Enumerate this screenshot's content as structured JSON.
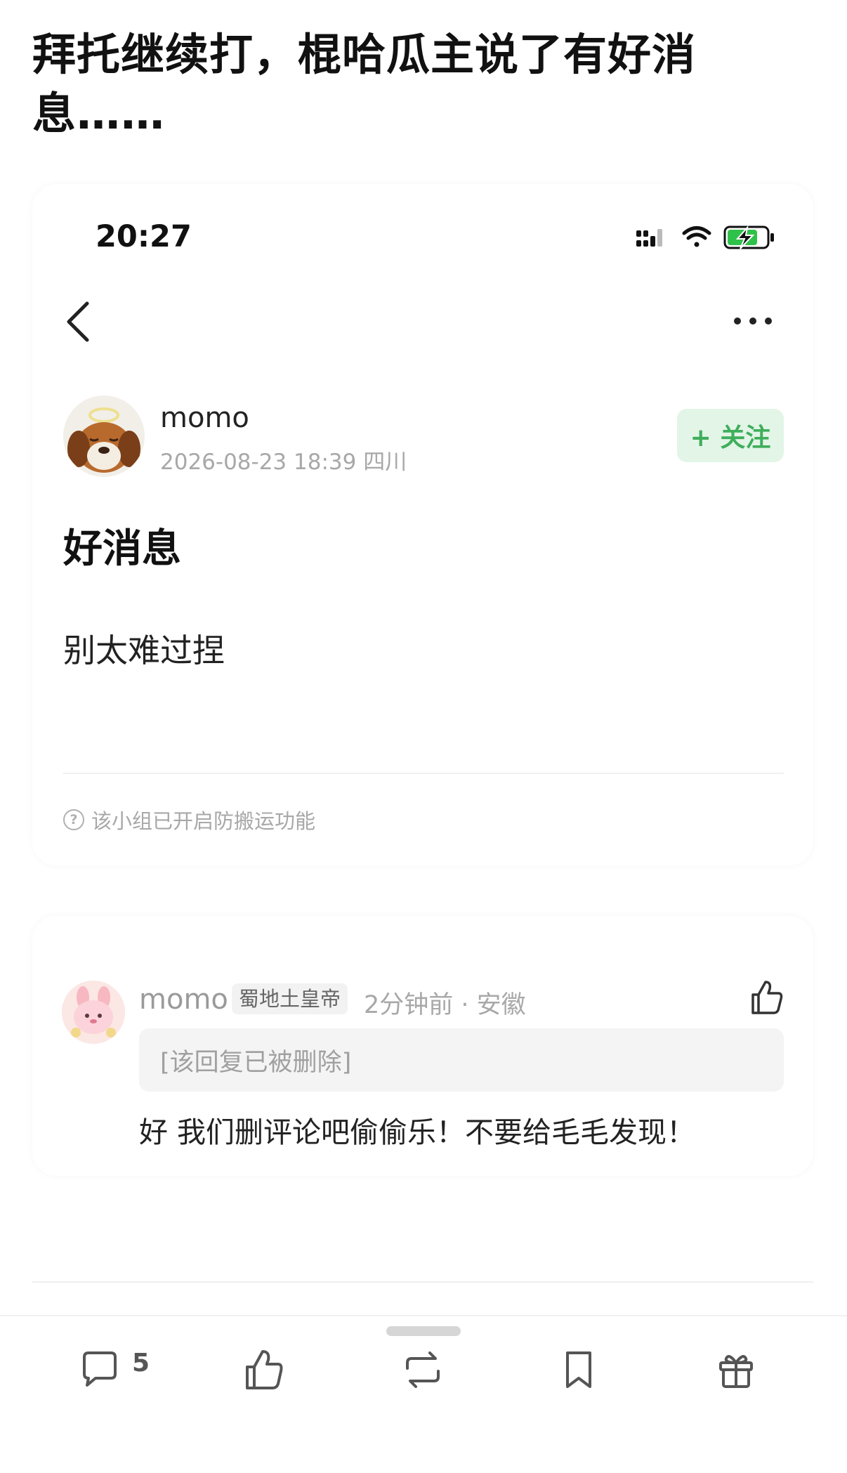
{
  "headline": "拜托继续打，棍哈瓜主说了有好消息……",
  "status_bar": {
    "time": "20:27"
  },
  "post": {
    "author": "momo",
    "meta": "2026-08-23 18:39  四川",
    "follow_label": "+ 关注",
    "title": "好消息",
    "body": "别太难过捏",
    "notice": "该小组已开启防搬运功能"
  },
  "comment": {
    "author": "momo",
    "badge": "蜀地土皇帝",
    "meta": "2分钟前 · 安徽",
    "deleted_reply": "[该回复已被删除]",
    "text": "好 我们删评论吧偷偷乐！不要给毛毛发现！"
  },
  "toolbar": {
    "comment_count": "5"
  },
  "icons": {
    "back": "chevron-left-icon",
    "more": "more-horizontal-icon",
    "signal": "signal-icon",
    "wifi": "wifi-icon",
    "battery": "battery-charging-icon",
    "like": "thumb-up-icon",
    "comment": "comment-icon",
    "repost": "repost-icon",
    "bookmark": "bookmark-icon",
    "gift": "gift-icon",
    "help": "help-circle-icon"
  },
  "colors": {
    "accent": "#3fae5b",
    "follow_bg": "#e2f5e7",
    "battery": "#2fc24a"
  }
}
